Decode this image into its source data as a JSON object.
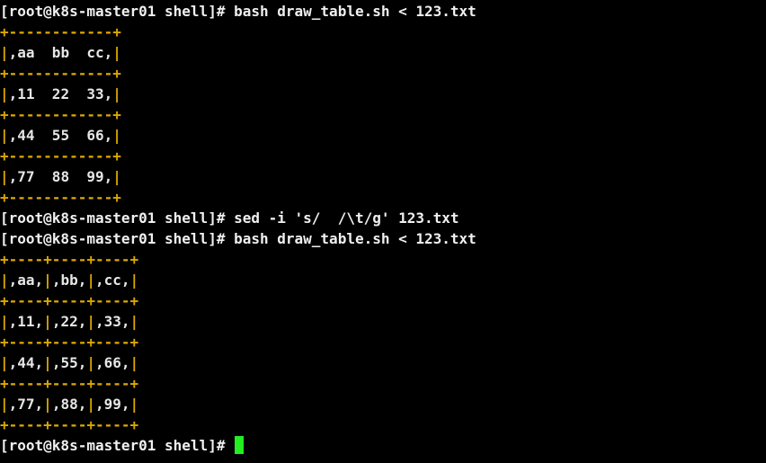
{
  "terminal": {
    "prompt": "[root@k8s-master01 shell]# ",
    "colors": {
      "background": "#000000",
      "text": "#f0f0f0",
      "table_border": "#dca800",
      "cursor": "#22ee22"
    },
    "cursor_icon": "block-cursor-icon",
    "lines": [
      {
        "type": "command",
        "text": "bash draw_table.sh < 123.txt"
      },
      {
        "type": "border",
        "text": "+------------+"
      },
      {
        "type": "row",
        "cells": [
          ",aa  bb  cc,"
        ]
      },
      {
        "type": "border",
        "text": "+------------+"
      },
      {
        "type": "row",
        "cells": [
          ",11  22  33,"
        ]
      },
      {
        "type": "border",
        "text": "+------------+"
      },
      {
        "type": "row",
        "cells": [
          ",44  55  66,"
        ]
      },
      {
        "type": "border",
        "text": "+------------+"
      },
      {
        "type": "row",
        "cells": [
          ",77  88  99,"
        ]
      },
      {
        "type": "border",
        "text": "+------------+"
      },
      {
        "type": "command",
        "text": "sed -i 's/  /\\t/g' 123.txt"
      },
      {
        "type": "command",
        "text": "bash draw_table.sh < 123.txt"
      },
      {
        "type": "border",
        "text": "+----+----+----+"
      },
      {
        "type": "row",
        "cells": [
          ",aa,",
          ",bb,",
          ",cc,"
        ]
      },
      {
        "type": "border",
        "text": "+----+----+----+"
      },
      {
        "type": "row",
        "cells": [
          ",11,",
          ",22,",
          ",33,"
        ]
      },
      {
        "type": "border",
        "text": "+----+----+----+"
      },
      {
        "type": "row",
        "cells": [
          ",44,",
          ",55,",
          ",66,"
        ]
      },
      {
        "type": "border",
        "text": "+----+----+----+"
      },
      {
        "type": "row",
        "cells": [
          ",77,",
          ",88,",
          ",99,"
        ]
      },
      {
        "type": "border",
        "text": "+----+----+----+"
      },
      {
        "type": "prompt",
        "text": ""
      }
    ]
  }
}
